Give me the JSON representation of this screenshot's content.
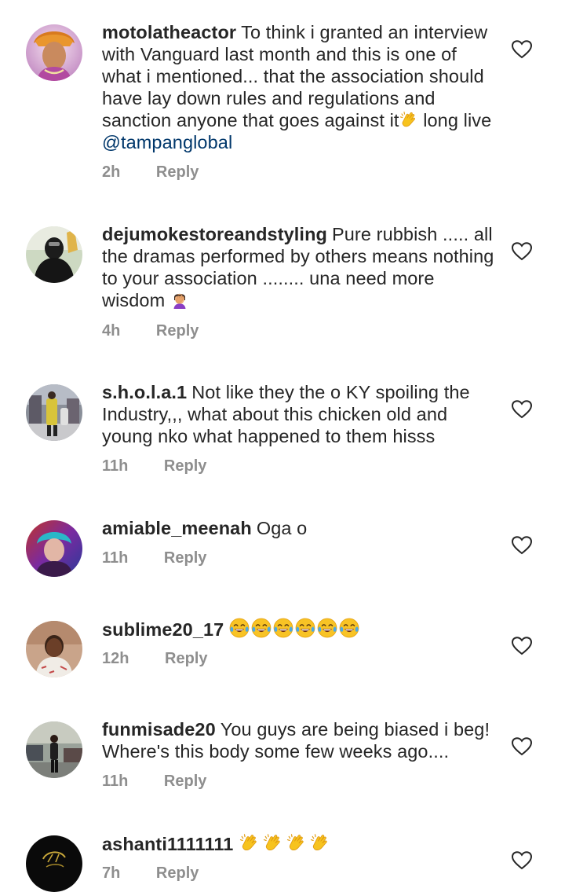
{
  "comments": [
    {
      "username": "motolatheactor",
      "text": "To think i granted an interview with Vanguard last month and this is one of what i mentioned... that the association should have lay down rules and regulations and sanction anyone that goes against it",
      "text_after_emoji": " long live ",
      "mention": "@tampanglobal",
      "time": "2h",
      "reply": "Reply"
    },
    {
      "username": "dejumokestoreandstyling",
      "text": "Pure rubbish ..... all the dramas performed by others means nothing to your association ........ una need more wisdom",
      "time": "4h",
      "reply": "Reply"
    },
    {
      "username": "s.h.o.l.a.1",
      "text": "Not like they the o KY spoiling the Industry,,, what about this chicken old and young nko what happened to them hisss",
      "time": "11h",
      "reply": "Reply"
    },
    {
      "username": "amiable_meenah",
      "text": "Oga o",
      "time": "11h",
      "reply": "Reply"
    },
    {
      "username": "sublime20_17",
      "text": "",
      "time": "12h",
      "reply": "Reply"
    },
    {
      "username": "funmisade20",
      "text": "You guys are being biased i beg! Where's this body some few weeks ago....",
      "time": "11h",
      "reply": "Reply"
    },
    {
      "username": "ashanti1111111",
      "text": "",
      "time": "7h",
      "reply": "Reply"
    }
  ],
  "icons": {
    "like": "heart-outline-icon",
    "clap": "clapping-hands-emoji",
    "facepalm": "facepalm-emoji",
    "laugh": "tears-of-joy-emoji"
  },
  "colors": {
    "text": "#262626",
    "meta": "#8e8e8e",
    "mention": "#00376b"
  }
}
